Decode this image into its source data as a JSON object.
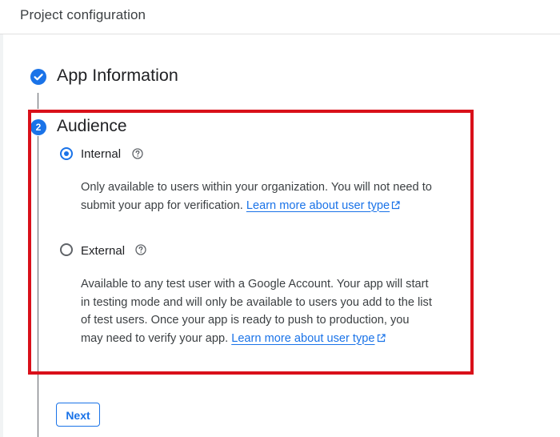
{
  "header": {
    "title": "Project configuration"
  },
  "steps": [
    {
      "number": "1",
      "title": "App Information",
      "status": "completed",
      "icon": "check-circle-icon"
    },
    {
      "number": "2",
      "title": "Audience",
      "status": "active"
    }
  ],
  "audience": {
    "selected": "Internal",
    "options": [
      {
        "label": "Internal",
        "checked": true,
        "help_icon": "help-circle-icon",
        "description_prefix": "Only available to users within your organization. You will not need to submit your app for verification. ",
        "link_text": "Learn more about user type",
        "link_icon": "external-link-icon"
      },
      {
        "label": "External",
        "checked": false,
        "help_icon": "help-circle-icon",
        "description_prefix": "Available to any test user with a Google Account. Your app will start in testing mode and will only be available to users you add to the list of test users. Once your app is ready to push to production, you may need to verify your app. ",
        "link_text": "Learn more about user type",
        "link_icon": "external-link-icon"
      }
    ]
  },
  "actions": {
    "next_label": "Next"
  },
  "colors": {
    "accent": "#1a73e8",
    "highlight_border": "#d9101a",
    "text_primary": "#202124",
    "text_secondary": "#3c4043"
  }
}
